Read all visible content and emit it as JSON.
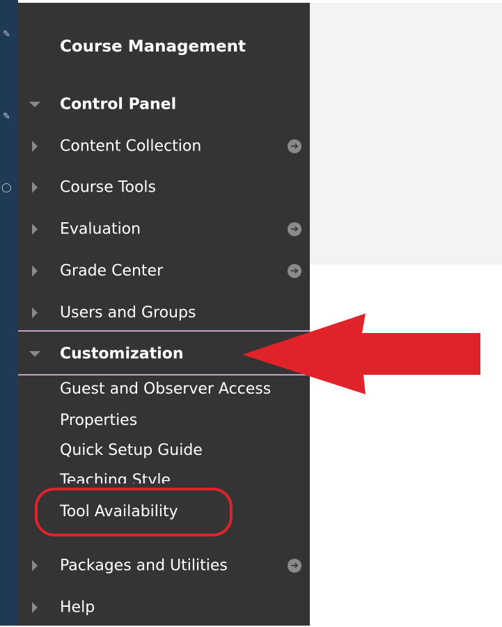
{
  "sidebar": {
    "title": "Course Management",
    "items": [
      {
        "label": "Control Panel",
        "expanded": true,
        "bold": true,
        "go": false
      },
      {
        "label": "Content Collection",
        "expanded": false,
        "bold": false,
        "go": true
      },
      {
        "label": "Course Tools",
        "expanded": false,
        "bold": false,
        "go": false
      },
      {
        "label": "Evaluation",
        "expanded": false,
        "bold": false,
        "go": true
      },
      {
        "label": "Grade Center",
        "expanded": false,
        "bold": false,
        "go": true
      },
      {
        "label": "Users and Groups",
        "expanded": false,
        "bold": false,
        "go": false
      },
      {
        "label": "Customization",
        "expanded": true,
        "bold": true,
        "go": false
      }
    ],
    "customization_subitems": [
      "Guest and Observer Access",
      "Properties",
      "Quick Setup Guide",
      "Teaching Style",
      "Tool Availability"
    ],
    "bottom_items": [
      {
        "label": "Packages and Utilities",
        "go": true
      },
      {
        "label": "Help",
        "go": false
      }
    ]
  },
  "colors": {
    "panel_bg": "#343434",
    "left_strip": "#1f3a55",
    "annotation_red": "#e0222a",
    "separator": "#c8a3c8",
    "grey_area": "#f3f3f3"
  },
  "icons": {
    "go_arrow": "circle-arrow-right-icon",
    "expand": "triangle-right-icon",
    "collapse": "triangle-down-icon"
  }
}
